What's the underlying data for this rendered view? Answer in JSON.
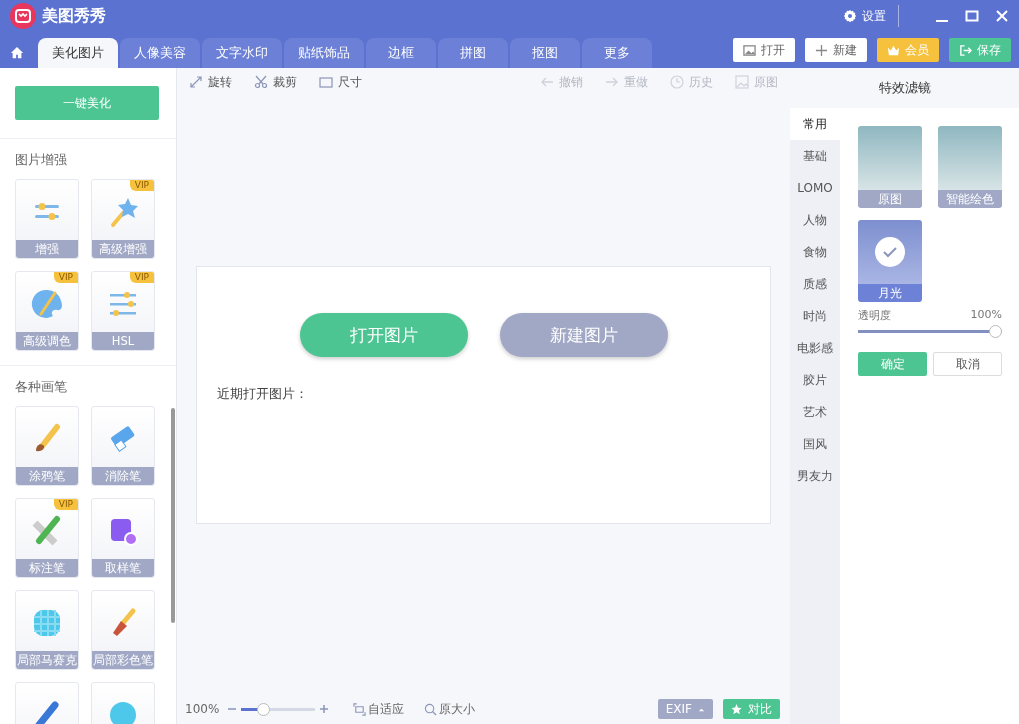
{
  "app": {
    "title": "美图秀秀",
    "settings": "设置"
  },
  "tabs": [
    {
      "label": "美化图片",
      "selected": true
    },
    {
      "label": "人像美容",
      "selected": false
    },
    {
      "label": "文字水印",
      "selected": false
    },
    {
      "label": "贴纸饰品",
      "selected": false
    },
    {
      "label": "边框",
      "selected": false
    },
    {
      "label": "拼图",
      "selected": false
    },
    {
      "label": "抠图",
      "selected": false
    },
    {
      "label": "更多",
      "selected": false
    }
  ],
  "actions": [
    {
      "kind": "open",
      "label": "打开"
    },
    {
      "kind": "new",
      "label": "新建"
    },
    {
      "kind": "vip",
      "label": "会员"
    },
    {
      "kind": "save",
      "label": "保存"
    }
  ],
  "sidebar": {
    "auto_button": "一键美化",
    "sections": [
      {
        "title": "图片增强",
        "tools": [
          {
            "kind": "sliders",
            "label": "增强"
          },
          {
            "kind": "wand",
            "label": "高级增强",
            "badge": "VIP"
          },
          {
            "kind": "palette",
            "label": "高级调色",
            "badge": "VIP"
          },
          {
            "kind": "hsl",
            "label": "HSL",
            "badge": "VIP"
          }
        ]
      },
      {
        "title": "各种画笔",
        "tools": [
          {
            "kind": "brush",
            "label": "涂鸦笔"
          },
          {
            "kind": "eraser",
            "label": "消除笔"
          },
          {
            "kind": "ruler",
            "label": "标注笔",
            "badge": "VIP"
          },
          {
            "kind": "picker",
            "label": "取样笔"
          },
          {
            "kind": "mosaic",
            "label": "局部马赛克"
          },
          {
            "kind": "paint",
            "label": "局部彩色笔"
          },
          {
            "kind": "pen"
          },
          {
            "kind": "bubble"
          }
        ]
      }
    ]
  },
  "toolbar": [
    {
      "kind": "rotate",
      "label": "旋转",
      "disabled": false
    },
    {
      "kind": "crop",
      "label": "裁剪",
      "disabled": false
    },
    {
      "kind": "size",
      "label": "尺寸",
      "disabled": false
    },
    {
      "kind": "undo",
      "label": "撤销",
      "disabled": true
    },
    {
      "kind": "redo",
      "label": "重做",
      "disabled": true
    },
    {
      "kind": "history",
      "label": "历史",
      "disabled": true
    },
    {
      "kind": "original",
      "label": "原图",
      "disabled": true
    }
  ],
  "canvas": {
    "open_button": "打开图片",
    "new_button": "新建图片",
    "recent_label": "近期打开图片："
  },
  "bottom_bar": {
    "zoom": "100%",
    "zoom_slider": {
      "level": 0.25
    },
    "fit": "自适应",
    "actual_size": "原大小",
    "exif": "EXIF",
    "compare": "对比"
  },
  "filters": {
    "title": "特效滤镜",
    "categories": [
      {
        "label": "常用",
        "selected": true
      },
      {
        "label": "基础",
        "selected": false
      },
      {
        "label": "LOMO",
        "selected": false
      },
      {
        "label": "人物",
        "selected": false
      },
      {
        "label": "食物",
        "selected": false
      },
      {
        "label": "质感",
        "selected": false
      },
      {
        "label": "时尚",
        "selected": false
      },
      {
        "label": "电影感",
        "selected": false
      },
      {
        "label": "胶片",
        "selected": false
      },
      {
        "label": "艺术",
        "selected": false
      },
      {
        "label": "国风",
        "selected": false
      },
      {
        "label": "男友力",
        "selected": false
      }
    ],
    "items": [
      {
        "label": "原图",
        "selected": false
      },
      {
        "label": "智能绘色",
        "selected": false
      },
      {
        "label": "月光",
        "selected": true
      }
    ],
    "opacity": {
      "label": "透明度",
      "value": "100%",
      "level": 1
    },
    "confirm": "确定",
    "cancel": "取消"
  }
}
